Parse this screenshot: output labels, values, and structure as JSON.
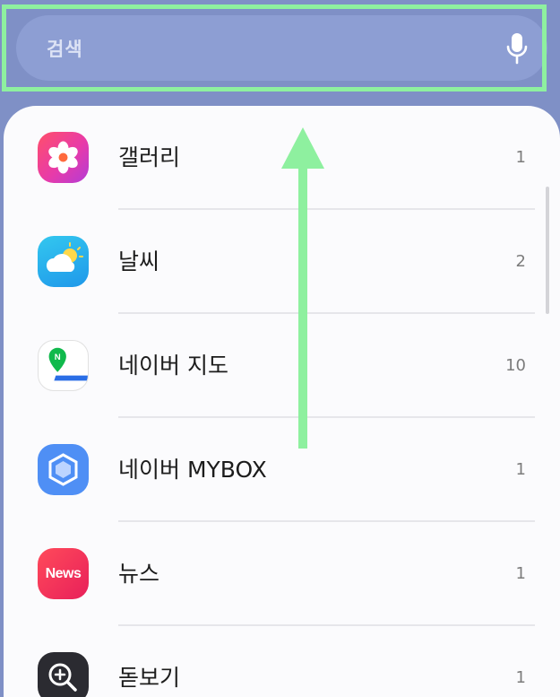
{
  "search": {
    "placeholder": "검색",
    "mic_icon": "microphone-icon"
  },
  "apps": [
    {
      "name": "갤러리",
      "count": "1",
      "icon": "gallery-icon"
    },
    {
      "name": "날씨",
      "count": "2",
      "icon": "weather-icon"
    },
    {
      "name": "네이버 지도",
      "count": "10",
      "icon": "naver-map-icon"
    },
    {
      "name": "네이버 MYBOX",
      "count": "1",
      "icon": "naver-mybox-icon"
    },
    {
      "name": "뉴스",
      "count": "1",
      "icon": "news-icon",
      "icon_text": "News"
    },
    {
      "name": "돋보기",
      "count": "1",
      "icon": "magnifier-icon"
    }
  ],
  "annotation": {
    "highlight_color": "#8ef09f",
    "arrow_direction": "up"
  },
  "colors": {
    "background": "#7f90c6",
    "search_bar": "#8d9ed3",
    "panel": "#fbfbfd"
  }
}
